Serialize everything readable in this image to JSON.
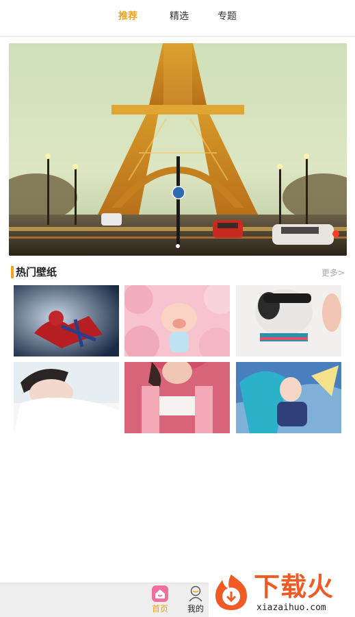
{
  "top_tabs": [
    {
      "label": "推荐",
      "active": true
    },
    {
      "label": "精选",
      "active": false
    },
    {
      "label": "专题",
      "active": false
    }
  ],
  "banner": {
    "subject": "Eiffel Tower at dusk with street traffic",
    "slide_count": 1,
    "active_slide": 1
  },
  "hot_section": {
    "title": "热门壁纸",
    "more_label": "更多>",
    "wallpapers": [
      {
        "subject": "spider-man crouching"
      },
      {
        "subject": "cartoon pig with pink balloons"
      },
      {
        "subject": "dog wearing sunglasses"
      },
      {
        "subject": "young man lying on white fur"
      },
      {
        "subject": "girl in pink jacket"
      },
      {
        "subject": "anime game heroine"
      }
    ]
  },
  "bottom_nav": {
    "items": [
      {
        "label": "首页",
        "icon": "home-icon",
        "active": true
      },
      {
        "label": "我的",
        "icon": "user-icon",
        "active": false
      }
    ]
  },
  "watermark": {
    "brand_cn": "下载火",
    "domain": "xiazaihuo.com"
  },
  "colors": {
    "accent": "#f5a21c",
    "home_icon_pink": "#f06fa0",
    "watermark_orange": "#f05a24"
  }
}
